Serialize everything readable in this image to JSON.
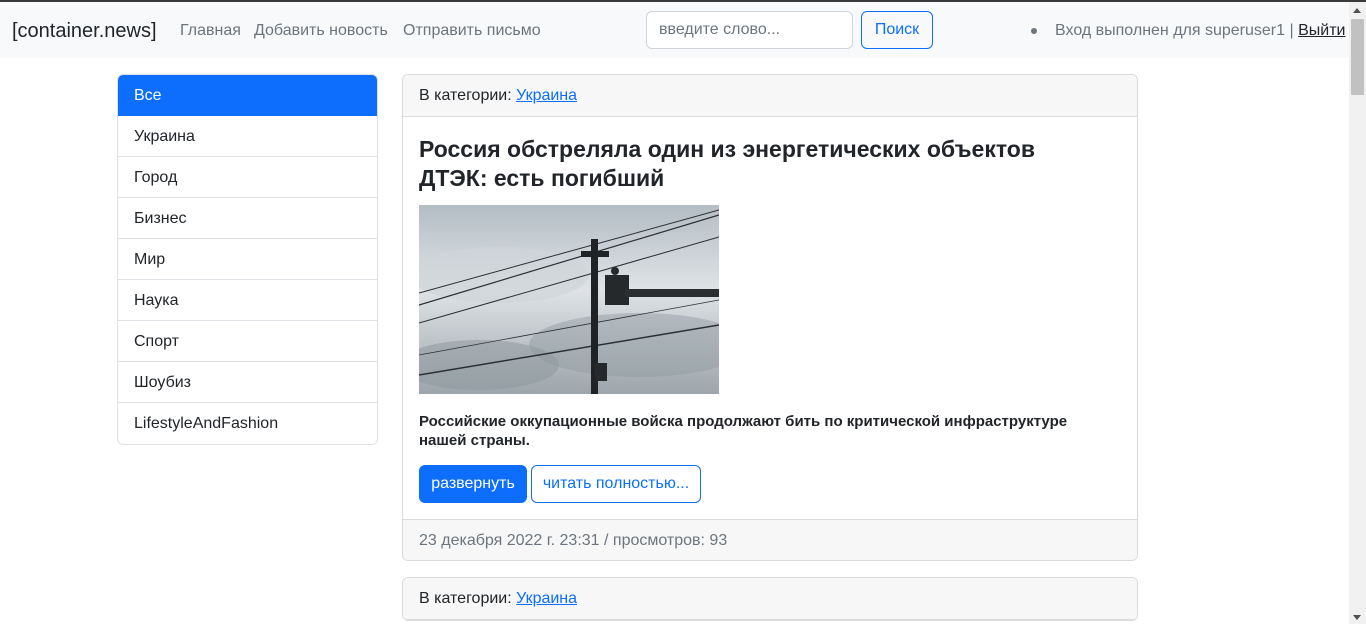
{
  "navbar": {
    "brand": "[container.news]",
    "links": [
      "Главная",
      "Добавить новость",
      "Отправить письмо"
    ],
    "search": {
      "placeholder": "введите слово...",
      "button": "Поиск"
    },
    "login_status": "Вход выполнен для superuser1 |",
    "logout": "Выйти"
  },
  "sidebar": {
    "items": [
      {
        "label": "Все",
        "active": true
      },
      {
        "label": "Украина"
      },
      {
        "label": "Город"
      },
      {
        "label": "Бизнес"
      },
      {
        "label": "Мир"
      },
      {
        "label": "Наука"
      },
      {
        "label": "Спорт"
      },
      {
        "label": "Шоубиз"
      },
      {
        "label": "LifestyleAndFashion"
      }
    ]
  },
  "articles": [
    {
      "category_prefix": "В категории:",
      "category": "Украина",
      "title": "Россия обстреляла один из энергетических объектов ДТЭК: есть погибший",
      "summary": "Российские оккупационные войска продолжают бить по критической инфраструктуре нашей страны.",
      "expand_button": "развернуть",
      "read_button": "читать полностью...",
      "meta": "23 декабря 2022 г. 23:31 / просмотров: 93"
    },
    {
      "category_prefix": "В категории:",
      "category": "Украина"
    }
  ],
  "colors": {
    "primary": "#0d6efd",
    "navbar_bg": "#f8f9fa",
    "muted": "#6c757d"
  }
}
